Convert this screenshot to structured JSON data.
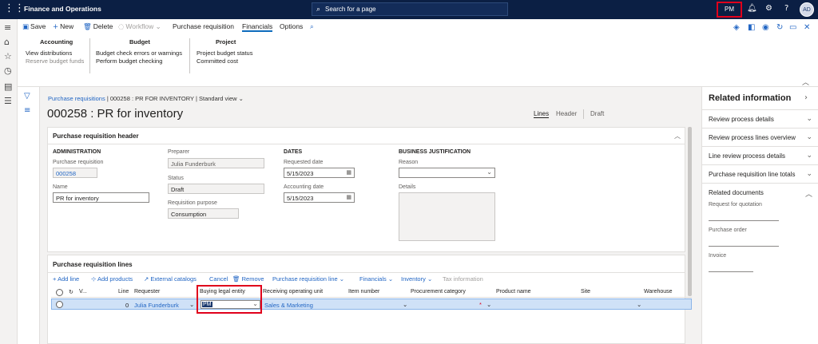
{
  "topbar": {
    "app_title": "Finance and Operations",
    "search_placeholder": "Search for a page",
    "company": "PM",
    "avatar": "AD"
  },
  "action_pane": {
    "save": "Save",
    "new": "New",
    "delete": "Delete",
    "workflow": "Workflow",
    "tabs": [
      "Purchase requisition",
      "Financials",
      "Options"
    ],
    "active_tab": "Financials",
    "groups": {
      "accounting": {
        "title": "Accounting",
        "links": [
          "View distributions",
          "Reserve budget funds"
        ]
      },
      "budget": {
        "title": "Budget",
        "links": [
          "Budget check errors or warnings",
          "Perform budget checking"
        ]
      },
      "project": {
        "title": "Project",
        "links": [
          "Project budget status",
          "Committed cost"
        ]
      }
    }
  },
  "page": {
    "breadcrumb_link": "Purchase requisitions",
    "breadcrumb_rest": "|  000258 : PR FOR INVENTORY  |  Standard view",
    "title": "000258 : PR for inventory",
    "view_lines": "Lines",
    "view_header": "Header",
    "status": "Draft"
  },
  "header_card": {
    "title": "Purchase requisition header",
    "administration": {
      "group": "ADMINISTRATION",
      "pr_label": "Purchase requisition",
      "pr_value": "000258",
      "name_label": "Name",
      "name_value": "PR for inventory"
    },
    "preparer": {
      "preparer_label": "Preparer",
      "preparer_value": "Julia Funderburk",
      "status_label": "Status",
      "status_value": "Draft",
      "purpose_label": "Requisition purpose",
      "purpose_value": "Consumption"
    },
    "dates": {
      "group": "DATES",
      "requested_label": "Requested date",
      "requested_value": "5/15/2023",
      "accounting_label": "Accounting date",
      "accounting_value": "5/15/2023"
    },
    "justification": {
      "group": "BUSINESS JUSTIFICATION",
      "reason_label": "Reason",
      "reason_value": "",
      "details_label": "Details"
    }
  },
  "lines_card": {
    "title": "Purchase requisition lines",
    "toolbar": {
      "add_line": "Add line",
      "add_products": "Add products",
      "external_catalogs": "External catalogs",
      "cancel": "Cancel",
      "remove": "Remove",
      "pr_line": "Purchase requisition line",
      "financials": "Financials",
      "inventory": "Inventory",
      "tax": "Tax information"
    },
    "columns": [
      "V...",
      "Line",
      "Requester",
      "Buying legal entity",
      "Receiving operating unit",
      "Item number",
      "Procurement category",
      "Product name",
      "Site",
      "Warehouse"
    ],
    "row": {
      "line": "0",
      "requester": "Julia Funderburk",
      "buying_legal_entity": "PM",
      "receiving_unit": "Sales & Marketing",
      "item_number": "",
      "procurement_category": "",
      "product_name": "",
      "site": "",
      "warehouse": ""
    }
  },
  "related": {
    "title": "Related information",
    "items": [
      "Review process details",
      "Review process lines overview",
      "Line review process details",
      "Purchase requisition line totals"
    ],
    "docs_title": "Related documents",
    "docs": [
      "Request for quotation",
      "Purchase order",
      "Invoice"
    ]
  }
}
